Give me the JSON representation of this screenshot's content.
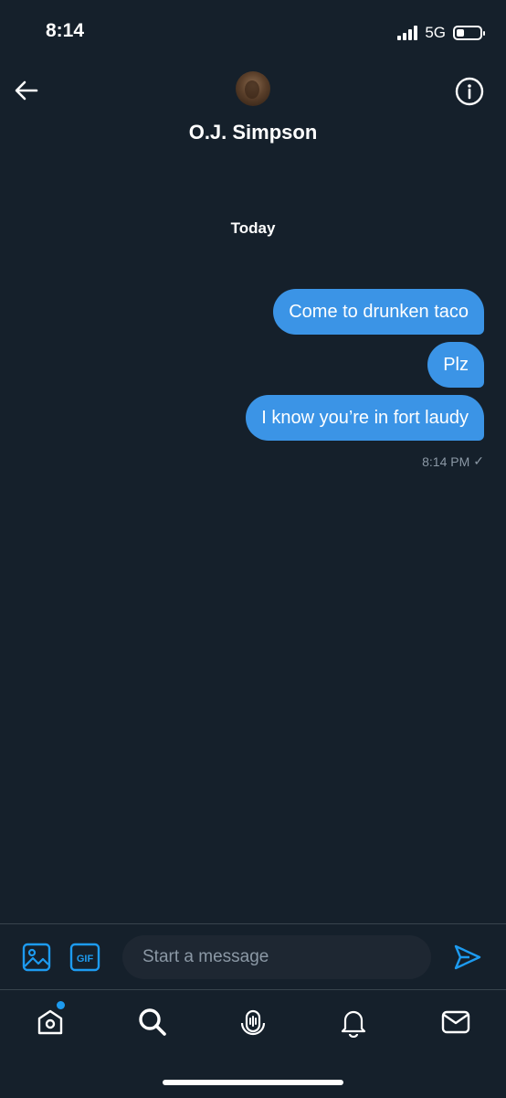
{
  "status_bar": {
    "time": "8:14",
    "network": "5G"
  },
  "header": {
    "contact_name": "O.J. Simpson"
  },
  "conversation": {
    "date_label": "Today",
    "messages": [
      {
        "text": "Come to drunken taco"
      },
      {
        "text": "Plz"
      },
      {
        "text": "I know you’re in fort laudy"
      }
    ],
    "timestamp": "8:14 PM",
    "receipt": "✓"
  },
  "composer": {
    "placeholder": "Start a message",
    "gif_label": "GIF"
  },
  "colors": {
    "background": "#15202b",
    "bubble": "#3b94e6",
    "accent": "#1d9bf0",
    "muted": "#8b98a5"
  },
  "icons": [
    "back-arrow-icon",
    "info-icon",
    "image-icon",
    "gif-icon",
    "send-icon",
    "home-icon",
    "search-icon",
    "spaces-icon",
    "bell-icon",
    "mail-icon"
  ]
}
